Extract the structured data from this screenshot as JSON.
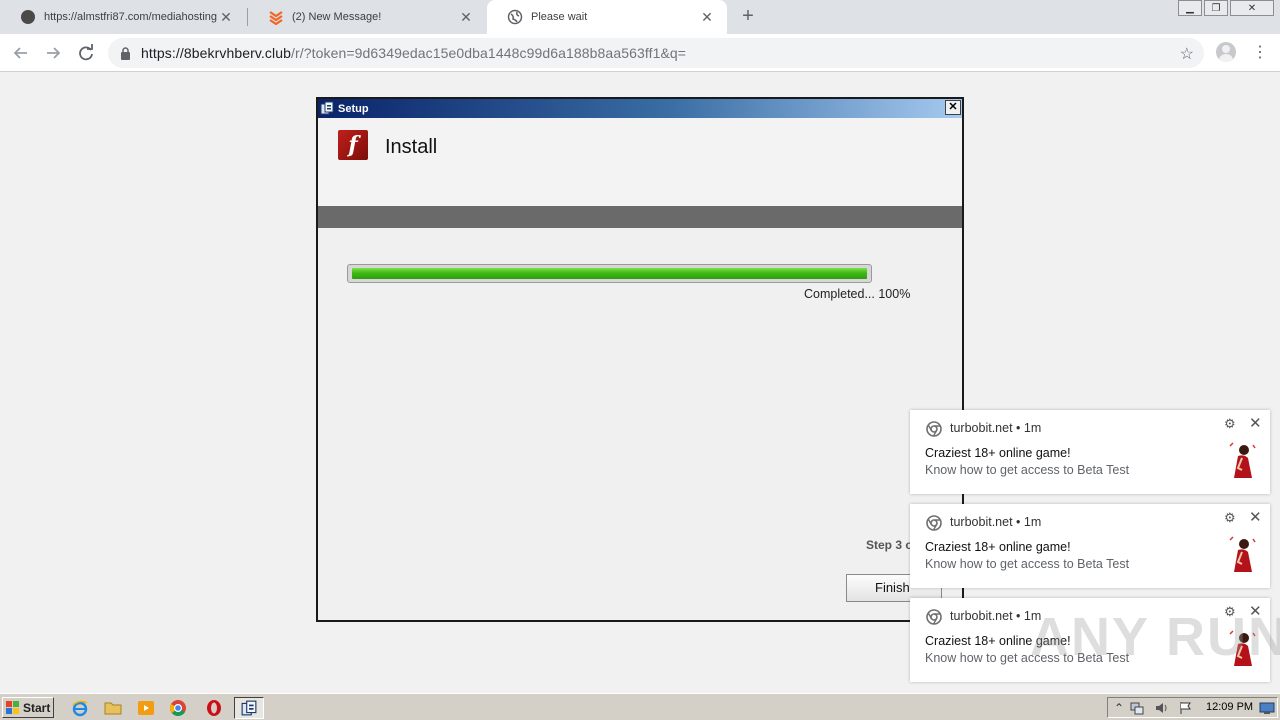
{
  "browser": {
    "tabs": [
      {
        "title": "https://almstfri87.com/mediahosting",
        "icon": "globe-dark-icon",
        "active": false
      },
      {
        "title": "(2) New Message!",
        "icon": "stack-orange-icon",
        "active": false
      },
      {
        "title": "Please wait",
        "icon": "globe-icon",
        "active": true
      }
    ],
    "new_tab": "+",
    "url_host": "https://8bekrvhberv.club",
    "url_path": "/r/?token=9d6349edac15e0dba1448c99d6a188b8aa563ff1&q="
  },
  "dialog": {
    "window_title": "Setup",
    "close_label": "✕",
    "heading": "Install",
    "progress_text": "Completed... 100%",
    "progress_value": 1.0,
    "step_text": "Step 3 o",
    "finish_label": "Finish"
  },
  "notifications": [
    {
      "source": "turbobit.net • 1m",
      "title": "Craziest 18+ online game!",
      "body": "Know how to get access to Beta Test"
    },
    {
      "source": "turbobit.net • 1m",
      "title": "Craziest 18+ online game!",
      "body": "Know how to get access to Beta Test"
    },
    {
      "source": "turbobit.net • 1m",
      "title": "Craziest 18+ online game!",
      "body": "Know how to get access to Beta Test"
    }
  ],
  "watermark": "ANY RUN",
  "taskbar": {
    "start_label": "Start",
    "clock": "12:09 PM"
  },
  "colors": {
    "progress_green": "#3fb818",
    "title_bar_start": "#0a246a",
    "flash_red": "#c0201a"
  }
}
